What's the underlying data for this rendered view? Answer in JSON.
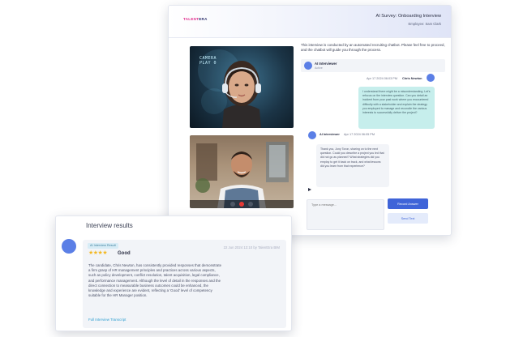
{
  "app": {
    "brand_part1": "TALENT",
    "brand_part2": "ERA",
    "survey_title": "AI Survey: Onboarding Interview",
    "employee_line": "Employee: Sam Clark",
    "camera_label_line1": "CAMERA",
    "camera_label_line2": "PLAY 0",
    "intro_text": "This interview is conducted by an automated recruiting chatbot. Please feel free to proceed, and the chatbot will guide you through the process.",
    "ai_name": "AI Interviewer",
    "ai_status": "Active",
    "candidate_message": {
      "meta": "Apr 17 2024 06:03 PM",
      "author": "Chris Newton",
      "text": "I understand there might be a misunderstanding. Let's refocus on the interview question. Can you detail an incident from your past work where you encountered difficulty with a stakeholder and explain the strategy you employed to manage and reconcile the various interests to successfully deliver the project?"
    },
    "ai_message": {
      "author": "AI Interviewer",
      "meta": "Apr 17 2024 06:05 PM",
      "text": "Thank you, Jony Toron, sharing on to the next question. Could you describe a project you led that did not go as planned? What strategies did you employ to get it back on track, and what lessons did you learn from that experience?"
    },
    "input_placeholder": "Type a message...",
    "record_button": "Record Answer",
    "send_button": "Send Text"
  },
  "results": {
    "title": "Interview results",
    "badge": "AI Interview Result",
    "stars": "★★★★",
    "star_count": 4,
    "star_max": 5,
    "rating_label": "Good",
    "date": "22 Jun 2024 13:10 by TalentEra BIM",
    "summary": "The candidate, Chris Newton, has consistently provided responses that demonstrate a firm grasp of HR management principles and practices across various aspects, such as policy development, conflict resolution, talent acquisition, legal compliance, and performance management. Although the level of detail in the responses and the direct connection to measurable business outcomes could be enhanced, the knowledge and experience are evident, reflecting a 'Good' level of competency suitable for the HR Manager position.",
    "transcript_link": "Full Interview Transcript"
  },
  "colors": {
    "primary": "#3f64d8",
    "brand_pink": "#e0288a",
    "candidate_bubble": "#c6eeec",
    "star": "#f3b821",
    "link": "#2f9fd0"
  }
}
